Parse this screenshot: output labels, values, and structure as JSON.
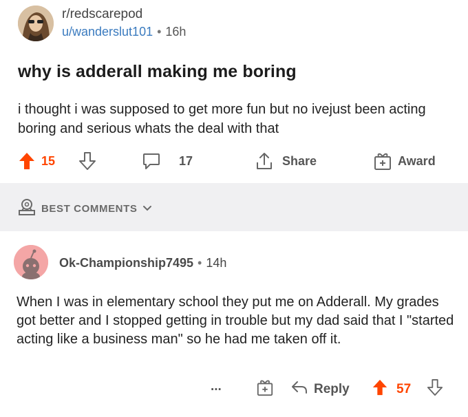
{
  "post": {
    "subreddit": "r/redscarepod",
    "author": "u/wanderslut101",
    "separator": "•",
    "age": "16h",
    "title": "why is adderall making me boring",
    "body": "i thought i was supposed to get more fun but no ivejust been acting boring and serious whats the deal with that",
    "upvotes": "15",
    "comments": "17",
    "share_label": "Share",
    "award_label": "Award"
  },
  "sort": {
    "label": "BEST COMMENTS"
  },
  "comment": {
    "author": "Ok-Championship7495",
    "separator": "•",
    "age": "14h",
    "body": "When I was in elementary school they put me on Adderall. My grades got better and I stopped getting in trouble but my dad said that I \"started acting like a business man\" so he had me taken off it.",
    "more": "...",
    "reply_label": "Reply",
    "upvotes": "57"
  },
  "colors": {
    "upvote_active": "#ff4500",
    "username_link": "#3b7bbf",
    "band_bg": "#f0f0f2"
  },
  "icons": [
    "avatar",
    "upvote-icon",
    "downvote-icon",
    "comment-icon",
    "share-icon",
    "award-icon",
    "trophy-icon",
    "chevron-down-icon",
    "snoo-avatar",
    "reply-icon"
  ]
}
